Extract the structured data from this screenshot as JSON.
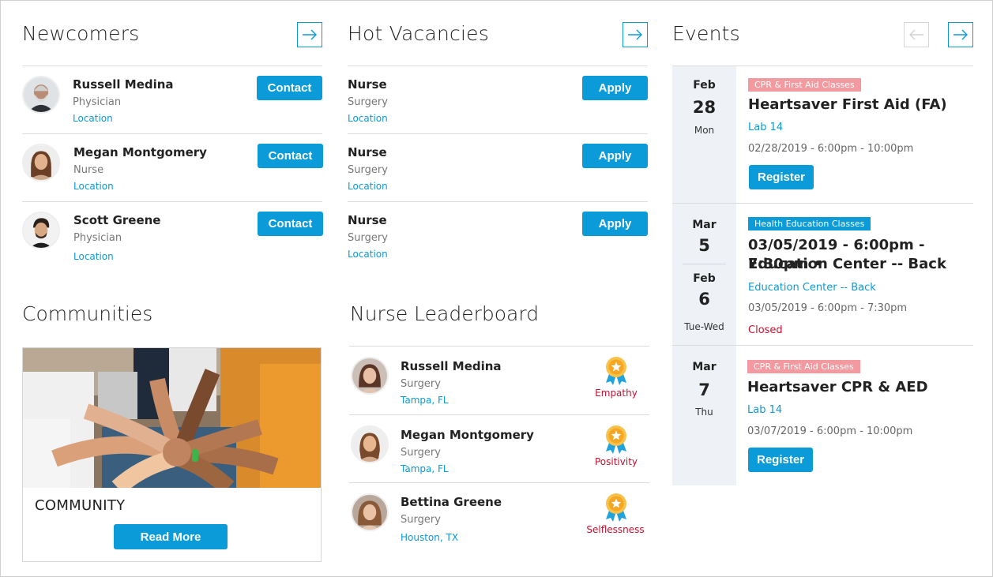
{
  "colors": {
    "accent": "#0a9bd8",
    "tag_cpr": "#f29a9f",
    "tag_health": "#0a9bd8",
    "badge_text": "#c8102e",
    "date_panel": "#eef2f6"
  },
  "newcomers": {
    "title": "Newcomers",
    "next_icon": "arrow-right-icon",
    "items": [
      {
        "name": "Russell Medina",
        "role": "Physician",
        "location": "Location",
        "action": "Contact"
      },
      {
        "name": "Megan Montgomery",
        "role": "Nurse",
        "location": "Location",
        "action": "Contact"
      },
      {
        "name": "Scott Greene",
        "role": "Physician",
        "location": "Location",
        "action": "Contact"
      }
    ]
  },
  "vacancies": {
    "title": "Hot Vacancies",
    "next_icon": "arrow-right-icon",
    "items": [
      {
        "title": "Nurse",
        "department": "Surgery",
        "location": "Location",
        "action": "Apply"
      },
      {
        "title": "Nurse",
        "department": "Surgery",
        "location": "Location",
        "action": "Apply"
      },
      {
        "title": "Nurse",
        "department": "Surgery",
        "location": "Location",
        "action": "Apply"
      }
    ]
  },
  "events": {
    "title": "Events",
    "prev_icon": "arrow-left-icon",
    "next_icon": "arrow-right-icon",
    "items": [
      {
        "month": "Feb",
        "day": "28",
        "dow": "Mon",
        "tag": "CPR & First Aid Classes",
        "title": "Heartsaver First Aid (FA)",
        "place": "Lab 14",
        "time": "02/28/2019 - 6:00pm - 10:00pm",
        "action": "Register"
      },
      {
        "month": "Mar",
        "day": "5",
        "month2": "Feb",
        "day2": "6",
        "dow": "Tue-Wed",
        "tag": "Health Education Classes",
        "title_line1": "03/05/2019 - 6:00pm - 7:30pm •",
        "title_line2": "Education Center -- Back",
        "place": "Education Center -- Back",
        "time": "03/05/2019 - 6:00pm - 7:30pm",
        "status": "Closed"
      },
      {
        "month": "Mar",
        "day": "7",
        "dow": "Thu",
        "tag": "CPR & First Aid Classes",
        "title": "Heartsaver CPR & AED",
        "place": "Lab 14",
        "time": "03/07/2019 - 6:00pm - 10:00pm",
        "action": "Register"
      }
    ]
  },
  "communities": {
    "title": "Communities",
    "card_label": "COMMUNITY",
    "action": "Read More"
  },
  "leaderboard": {
    "title": "Nurse Leaderboard",
    "badge_icon": "award-ribbon-icon",
    "items": [
      {
        "name": "Russell Medina",
        "department": "Surgery",
        "location": "Tampa, FL",
        "badge": "Empathy"
      },
      {
        "name": "Megan Montgomery",
        "department": "Surgery",
        "location": "Tampa, FL",
        "badge": "Positivity"
      },
      {
        "name": "Bettina Greene",
        "department": "Surgery",
        "location": "Houston, TX",
        "badge": "Selflessness"
      }
    ]
  }
}
